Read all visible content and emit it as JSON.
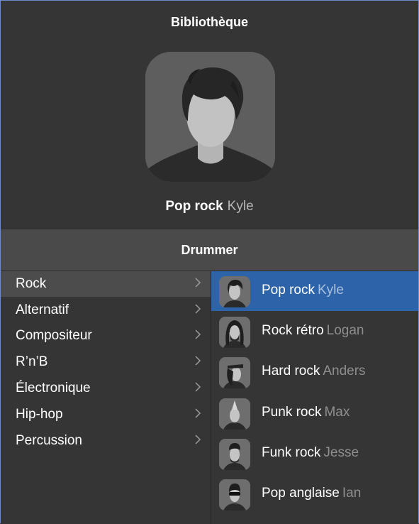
{
  "library": {
    "title": "Bibliothèque",
    "current_genre": "Pop rock",
    "current_drummer": "Kyle"
  },
  "section": {
    "title": "Drummer"
  },
  "categories": [
    {
      "label": "Rock",
      "selected": true
    },
    {
      "label": "Alternatif"
    },
    {
      "label": "Compositeur"
    },
    {
      "label": "R’n’B"
    },
    {
      "label": "Électronique"
    },
    {
      "label": "Hip-hop"
    },
    {
      "label": "Percussion"
    }
  ],
  "drummers": [
    {
      "genre": "Pop rock",
      "name": "Kyle",
      "selected": true,
      "icon": "drummer-kyle-avatar"
    },
    {
      "genre": "Rock rétro",
      "name": "Logan",
      "icon": "drummer-logan-avatar"
    },
    {
      "genre": "Hard rock",
      "name": "Anders",
      "icon": "drummer-anders-avatar"
    },
    {
      "genre": "Punk rock",
      "name": "Max",
      "icon": "drummer-max-avatar"
    },
    {
      "genre": "Funk rock",
      "name": "Jesse",
      "icon": "drummer-jesse-avatar"
    },
    {
      "genre": "Pop anglaise",
      "name": "Ian",
      "icon": "drummer-ian-avatar"
    }
  ],
  "colors": {
    "selection_blue": "#2d63a8",
    "panel_bg": "#353535",
    "header_bar": "#4a4a4a",
    "secondary_text": "#8e8e8e"
  }
}
